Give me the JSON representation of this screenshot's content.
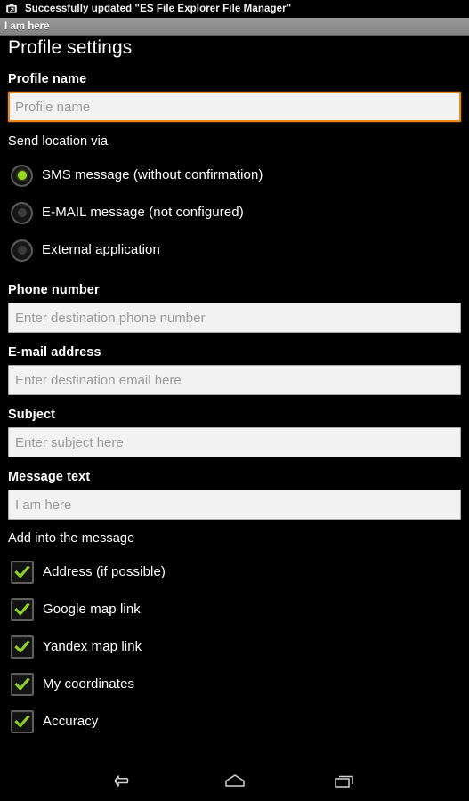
{
  "statusbar": {
    "icon": "app-update-icon",
    "text": "Successfully updated \"ES File Explorer File Manager\""
  },
  "actionbar": {
    "title": "I am here"
  },
  "page": {
    "title": "Profile settings"
  },
  "profile_name": {
    "label": "Profile name",
    "value": "",
    "placeholder": "Profile name",
    "focused": true
  },
  "send_location": {
    "label": "Send location via",
    "options": [
      {
        "label": "SMS message (without confirmation)",
        "checked": true
      },
      {
        "label": "E-MAIL message (not configured)",
        "checked": false
      },
      {
        "label": "External application",
        "checked": false
      }
    ]
  },
  "phone_number": {
    "label": "Phone number",
    "value": "",
    "placeholder": "Enter destination phone number"
  },
  "email_address": {
    "label": "E-mail address",
    "value": "",
    "placeholder": "Enter destination email here"
  },
  "subject": {
    "label": "Subject",
    "value": "",
    "placeholder": "Enter subject here"
  },
  "message_text": {
    "label": "Message text",
    "value": "",
    "placeholder": "I am here"
  },
  "add_into_message": {
    "label": "Add into the message",
    "items": [
      {
        "label": "Address (if possible)",
        "checked": true
      },
      {
        "label": "Google map link",
        "checked": true
      },
      {
        "label": "Yandex map link",
        "checked": true
      },
      {
        "label": "My coordinates",
        "checked": true
      },
      {
        "label": "Accuracy",
        "checked": true
      }
    ]
  },
  "navbar": {
    "back": "back-button",
    "home": "home-button",
    "recents": "recents-button"
  },
  "colors": {
    "background": "#000000",
    "accent_green": "#95d523",
    "focus_orange": "#ec8a1e",
    "actionbar_gray": "#8d8d8d",
    "field_background": "#f2f2f2"
  }
}
